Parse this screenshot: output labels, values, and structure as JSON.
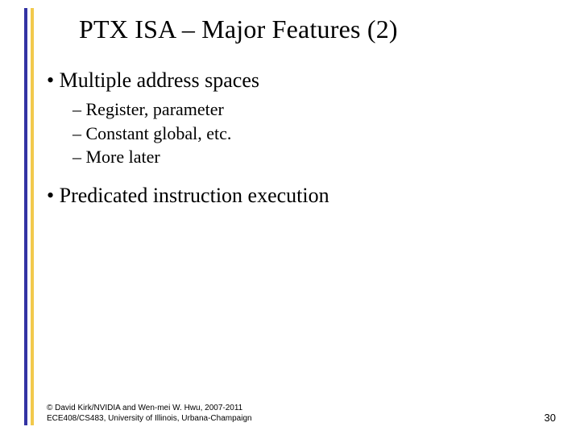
{
  "title": "PTX ISA – Major Features (2)",
  "bullets": {
    "b1": {
      "label": "Multiple address spaces",
      "subs": {
        "s1": "Register, parameter",
        "s2": "Constant global, etc.",
        "s3": "More later"
      }
    },
    "b2": {
      "label": "Predicated instruction execution"
    }
  },
  "footer": {
    "line1": "© David Kirk/NVIDIA and Wen-mei W. Hwu, 2007-2011",
    "line2": "ECE408/CS483, University of Illinois, Urbana-Champaign",
    "page": "30"
  }
}
